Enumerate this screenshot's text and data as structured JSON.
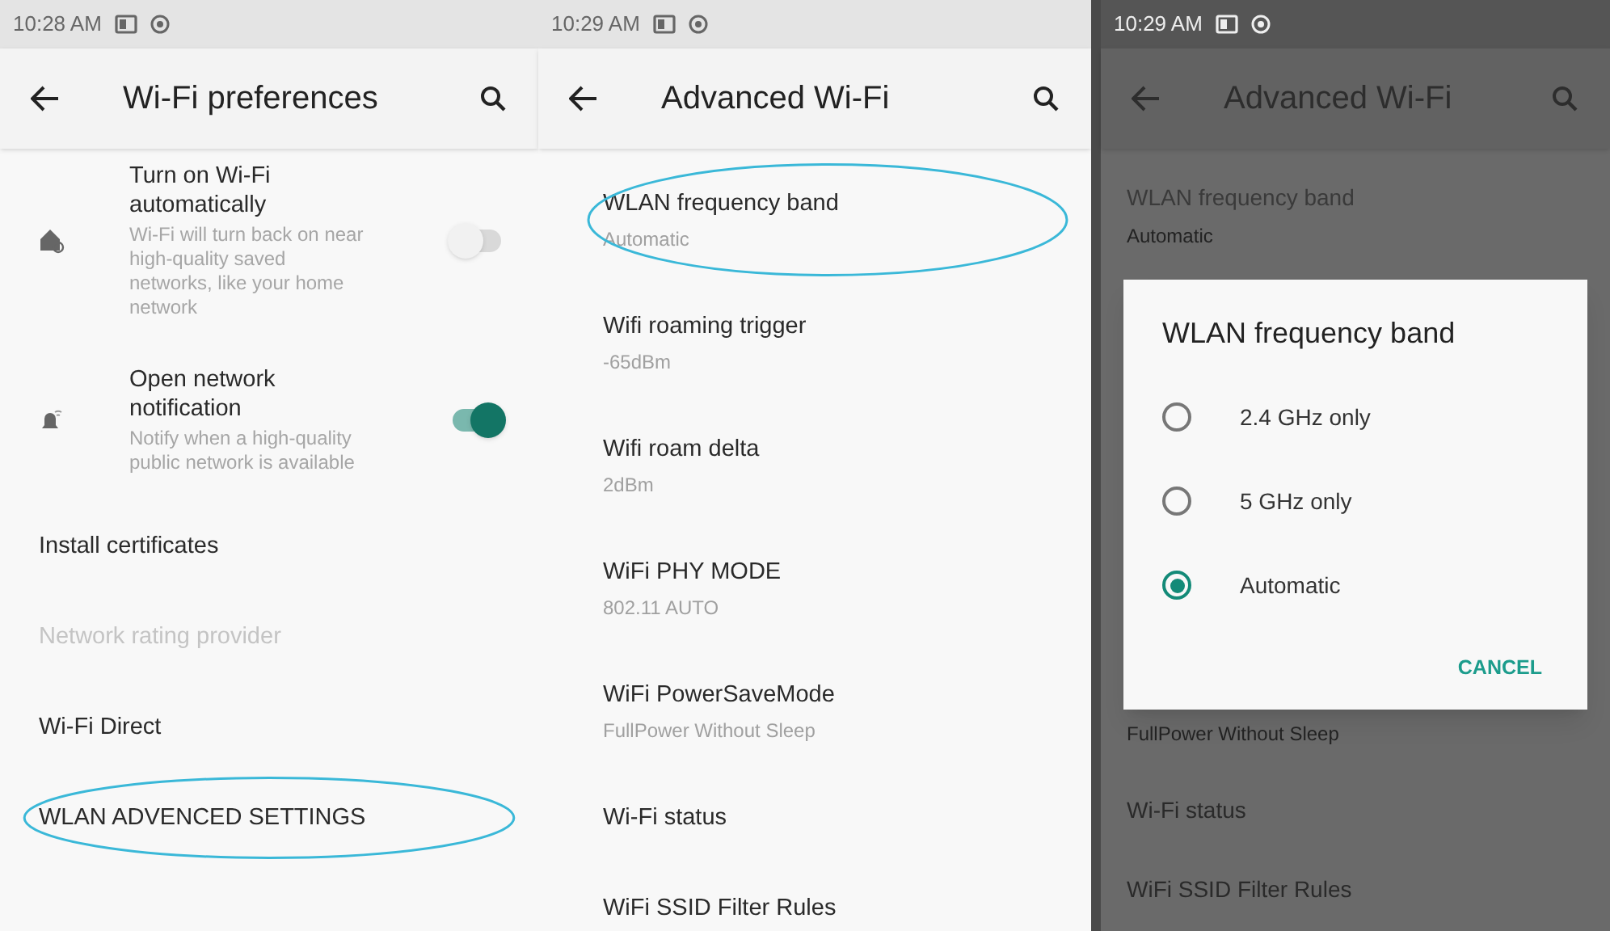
{
  "screens": [
    {
      "time": "10:28 AM",
      "title": "Wi-Fi preferences",
      "items": [
        {
          "kind": "toggle",
          "title": "Turn on Wi-Fi automatically",
          "summary": "Wi-Fi will turn back on near high-quality saved networks, like your home network",
          "on": false,
          "disabled": false,
          "highlighted": false
        },
        {
          "kind": "toggle",
          "title": "Open network notification",
          "summary": "Notify when a high-quality public network is available",
          "on": true,
          "disabled": false,
          "highlighted": false
        },
        {
          "kind": "plain",
          "title": "Install certificates",
          "disabled": false,
          "highlighted": false
        },
        {
          "kind": "plain",
          "title": "Network rating provider",
          "disabled": true,
          "highlighted": false
        },
        {
          "kind": "plain",
          "title": "Wi-Fi Direct",
          "disabled": false,
          "highlighted": false
        },
        {
          "kind": "plain",
          "title": "WLAN ADVENCED SETTINGS",
          "disabled": false,
          "highlighted": true
        }
      ]
    },
    {
      "time": "10:29 AM",
      "title": "Advanced Wi-Fi",
      "items": [
        {
          "kind": "plain",
          "title": "WLAN frequency band",
          "summary": "Automatic",
          "disabled": false,
          "highlighted": true
        },
        {
          "kind": "plain",
          "title": "Wifi roaming trigger",
          "summary": "-65dBm",
          "disabled": false,
          "highlighted": false
        },
        {
          "kind": "plain",
          "title": "Wifi roam delta",
          "summary": "2dBm",
          "disabled": false,
          "highlighted": false
        },
        {
          "kind": "plain",
          "title": "WiFi PHY MODE",
          "summary": "802.11 AUTO",
          "disabled": false,
          "highlighted": false
        },
        {
          "kind": "plain",
          "title": "WiFi PowerSaveMode",
          "summary": "FullPower Without Sleep",
          "disabled": false,
          "highlighted": false
        },
        {
          "kind": "plain",
          "title": "Wi-Fi status",
          "disabled": false,
          "highlighted": false
        },
        {
          "kind": "plain",
          "title": "WiFi SSID Filter Rules",
          "disabled": false,
          "highlighted": false
        }
      ]
    }
  ],
  "dialog_screen": {
    "time": "10:29 AM",
    "title": "Advanced Wi-Fi",
    "above": [
      {
        "title": "WLAN frequency band",
        "summary": "Automatic"
      }
    ],
    "dialog": {
      "title": "WLAN frequency band",
      "options": [
        {
          "label": "2.4 GHz only",
          "selected": false
        },
        {
          "label": "5 GHz only",
          "selected": false
        },
        {
          "label": "Automatic",
          "selected": true
        }
      ],
      "button": "CANCEL"
    },
    "below": [
      {
        "summary": "FullPower Without Sleep"
      },
      {
        "title": "Wi-Fi status"
      },
      {
        "title": "WiFi SSID Filter Rules"
      }
    ]
  }
}
